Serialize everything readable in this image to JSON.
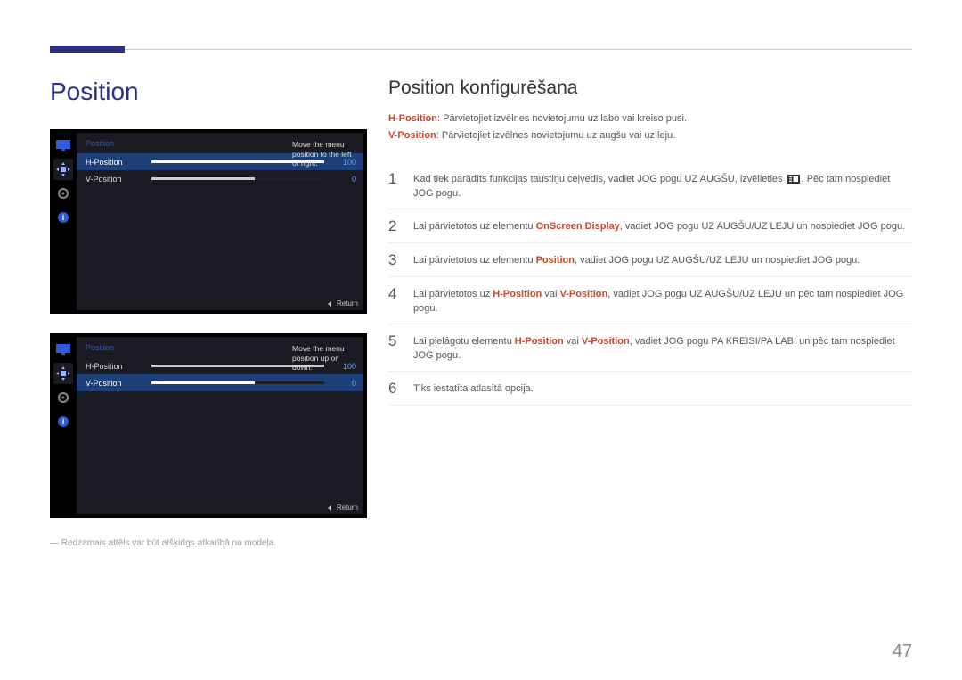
{
  "page_number": "47",
  "section_title": "Position",
  "subheading": "Position konfigurēšana",
  "desc": {
    "h_label": "H-Position",
    "h_text": ": Pārvietojiet izvēlnes novietojumu uz labo vai kreiso pusi.",
    "v_label": "V-Position",
    "v_text": ": Pārvietojiet izvēlnes novietojumu uz augšu vai uz leju."
  },
  "steps": [
    {
      "n": "1",
      "parts": [
        {
          "t": "Kad tiek parādīts funkcijas taustiņu ceļvedis, vadiet JOG pogu UZ AUGŠU, izvēlieties "
        },
        {
          "icon": "menu"
        },
        {
          "t": ". Pēc tam nospiediet JOG pogu."
        }
      ]
    },
    {
      "n": "2",
      "parts": [
        {
          "t": "Lai pārvietotos uz elementu "
        },
        {
          "kw": "OnScreen Display"
        },
        {
          "t": ", vadiet JOG pogu UZ AUGŠU/UZ LEJU un nospiediet JOG pogu."
        }
      ]
    },
    {
      "n": "3",
      "parts": [
        {
          "t": "Lai pārvietotos uz elementu "
        },
        {
          "kw": "Position"
        },
        {
          "t": ", vadiet JOG pogu UZ AUGŠU/UZ LEJU un nospiediet JOG pogu."
        }
      ]
    },
    {
      "n": "4",
      "parts": [
        {
          "t": "Lai pārvietotos uz "
        },
        {
          "kw": "H-Position"
        },
        {
          "t": " vai "
        },
        {
          "kw": "V-Position"
        },
        {
          "t": ", vadiet JOG pogu UZ AUGŠU/UZ LEJU un pēc tam nospiediet JOG pogu."
        }
      ]
    },
    {
      "n": "5",
      "parts": [
        {
          "t": "Lai pielāgotu elementu "
        },
        {
          "kw": "H-Position"
        },
        {
          "t": " vai "
        },
        {
          "kw": "V-Position"
        },
        {
          "t": ", vadiet JOG pogu PA KREISI/PA LABI un pēc tam nospiediet JOG pogu."
        }
      ]
    },
    {
      "n": "6",
      "parts": [
        {
          "t": "Tiks iestatīta atlasītā opcija."
        }
      ]
    }
  ],
  "osd": {
    "title": "Position",
    "return_label": "Return",
    "screen1": {
      "help": "Move the menu position to the left or right.",
      "rows": [
        {
          "label": "H-Position",
          "value": "100",
          "fill": 100,
          "selected": true
        },
        {
          "label": "V-Position",
          "value": "0",
          "fill": 60,
          "selected": false
        }
      ]
    },
    "screen2": {
      "help": "Move the menu position up or down.",
      "rows": [
        {
          "label": "H-Position",
          "value": "100",
          "fill": 100,
          "selected": false
        },
        {
          "label": "V-Position",
          "value": "0",
          "fill": 60,
          "selected": true
        }
      ]
    }
  },
  "footnote": "Redzamais attēls var būt atšķirīgs atkarībā no modeļa."
}
